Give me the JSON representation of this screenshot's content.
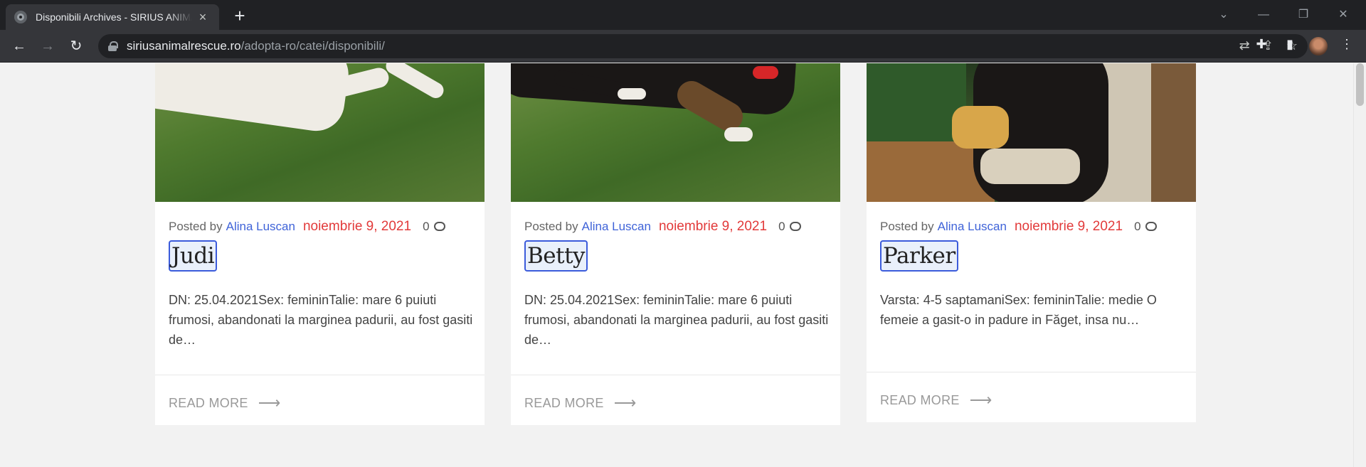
{
  "browser": {
    "tab_title": "Disponibili Archives - SIRIUS ANIMAL",
    "new_tab": "+",
    "url_host": "siriusanimalrescue.ro",
    "url_path": "/adopta-ro/catei/disponibili/"
  },
  "posts": [
    {
      "posted_by": "Posted by",
      "author": "Alina Luscan",
      "date": "noiembrie 9, 2021",
      "comments": "0",
      "title": "Judi",
      "excerpt": "DN: 25.04.2021Sex: femininTalie: mare 6 puiuti frumosi, abandonati la marginea padurii, au fost gasiti de…",
      "read_more": "READ MORE",
      "image_icon": "white-dog-on-grass"
    },
    {
      "posted_by": "Posted by",
      "author": "Alina Luscan",
      "date": "noiembrie 9, 2021",
      "comments": "0",
      "title": "Betty",
      "excerpt": "DN: 25.04.2021Sex: femininTalie: mare 6 puiuti frumosi, abandonati la marginea padurii, au fost gasiti de…",
      "read_more": "READ MORE",
      "image_icon": "black-dog-on-grass"
    },
    {
      "posted_by": "Posted by",
      "author": "Alina Luscan",
      "date": "noiembrie 9, 2021",
      "comments": "0",
      "title": "Parker",
      "excerpt": "Varsta: 4-5 saptamaniSex: femininTalie: medie O femeie a gasit-o in padure in Făget, insa nu…",
      "read_more": "READ MORE",
      "image_icon": "puppy-held-in-arms"
    }
  ],
  "colors": {
    "author_link": "#3f63d8",
    "date": "#e23a3a",
    "title_highlight_border": "#3b5bdb"
  }
}
